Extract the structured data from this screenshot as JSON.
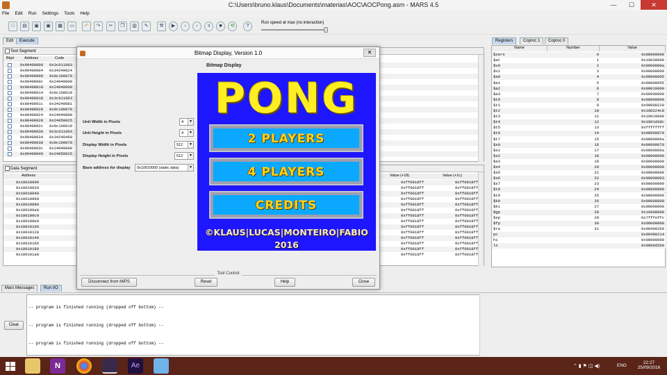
{
  "window": {
    "title": "C:\\Users\\bruno.klaus\\Documents\\materias\\AOC\\AOCPong.asm  -  MARS 4.5",
    "minimize": "—",
    "maximize": "☐",
    "close": "✕"
  },
  "menu": [
    "File",
    "Edit",
    "Run",
    "Settings",
    "Tools",
    "Help"
  ],
  "toolbar": {
    "runspeed_label": "Run speed at max (no interaction)",
    "buttons": [
      "new-icon",
      "open-icon",
      "save-icon",
      "saveas-icon",
      "dump-icon",
      "print-icon",
      "undo-icon",
      "redo-icon",
      "cut-icon",
      "copy-icon",
      "paste-icon",
      "findreplace-icon",
      "assemble-icon",
      "go-icon",
      "step-icon",
      "backstep-icon",
      "pause-icon",
      "stop-icon",
      "reset-icon",
      "help-icon"
    ]
  },
  "tabs": {
    "edit": "Edit",
    "execute": "Execute"
  },
  "text_segment": {
    "title": "Text Segment",
    "columns": [
      "Bkpt",
      "Address",
      "Code"
    ],
    "rows": [
      [
        "0x00400000",
        "0x3c011003"
      ],
      [
        "0x00400004",
        "0x34240024"
      ],
      [
        "0x00400008",
        "0x0c100078"
      ],
      [
        "0x0040000c",
        "0x24040000"
      ],
      [
        "0x00400010",
        "0x24040000"
      ],
      [
        "0x00400014",
        "0x0c100019"
      ],
      [
        "0x00400018",
        "0x3c011003"
      ],
      [
        "0x0040001c",
        "0x34240081"
      ],
      [
        "0x00400020",
        "0x0c100078"
      ],
      [
        "0x00400024",
        "0x24040008"
      ],
      [
        "0x00400028",
        "0x24050025"
      ],
      [
        "0x0040002c",
        "0x0c100019"
      ],
      [
        "0x00400030",
        "0x3c011003"
      ],
      [
        "0x00400034",
        "0x34240460"
      ],
      [
        "0x00400038",
        "0x0c100078"
      ],
      [
        "0x0040003c",
        "0x24040008"
      ],
      [
        "0x00400040",
        "0x24050025"
      ]
    ]
  },
  "data_segment": {
    "title": "Data Segment",
    "columns": [
      "Address",
      "Value (+18)",
      "Value (+1c)"
    ],
    "rows": [
      [
        "0x10010000",
        "0xff0018ff",
        "0xff0018ff"
      ],
      [
        "0x10010020",
        "0xff0018ff",
        "0xff0018ff"
      ],
      [
        "0x10010040",
        "0xff0018ff",
        "0xff0018ff"
      ],
      [
        "0x10010060",
        "0xff0018ff",
        "0xff0018ff"
      ],
      [
        "0x10010080",
        "0xff0018ff",
        "0xff0018ff"
      ],
      [
        "0x100100a0",
        "0xff0018ff",
        "0xff0018ff"
      ],
      [
        "0x100100c0",
        "0xff0018ff",
        "0xff0018ff"
      ],
      [
        "0x100100e0",
        "0xff0018ff",
        "0xff0018ff"
      ],
      [
        "0x10010100",
        "0xff0018ff",
        "0xff0018ff"
      ],
      [
        "0x10010120",
        "0xff0018ff",
        "0xff0018ff"
      ],
      [
        "0x10010140",
        "0xff0018ff",
        "0xff0018ff"
      ],
      [
        "0x10010160",
        "0xff0018ff",
        "0xff0018ff"
      ],
      [
        "0x10010180",
        "0xff0018ff",
        "0xff0018ff"
      ],
      [
        "0x100101a0",
        "0xff0018ff",
        "0xff0018ff"
      ]
    ]
  },
  "registers": {
    "tabs": [
      "Registers",
      "Coproc 1",
      "Coproc 0"
    ],
    "columns": [
      "Name",
      "Number",
      "Value"
    ],
    "rows": [
      [
        "$zero",
        "0",
        "0x00000000"
      ],
      [
        "$at",
        "1",
        "0x10030000"
      ],
      [
        "$v0",
        "2",
        "0x0000000a"
      ],
      [
        "$v1",
        "3",
        "0x00000000"
      ],
      [
        "$a0",
        "4",
        "0x00000005"
      ],
      [
        "$a1",
        "5",
        "0x00000055"
      ],
      [
        "$a2",
        "6",
        "0x00010000"
      ],
      [
        "$a3",
        "7",
        "0x00000000"
      ],
      [
        "$t0",
        "8",
        "0x00000000"
      ],
      [
        "$t1",
        "9",
        "0x00000220"
      ],
      [
        "$t2",
        "10",
        "0x100224c8"
      ],
      [
        "$t3",
        "11",
        "0x10010000"
      ],
      [
        "$t4",
        "12",
        "0x1001d3dc"
      ],
      [
        "$t5",
        "13",
        "0xffffffff"
      ],
      [
        "$t6",
        "14",
        "0x00000078"
      ],
      [
        "$t7",
        "15",
        "0x0000006a"
      ],
      [
        "$s0",
        "16",
        "0x00000078"
      ],
      [
        "$s1",
        "17",
        "0x0000006a"
      ],
      [
        "$s2",
        "18",
        "0x00000000"
      ],
      [
        "$s3",
        "19",
        "0x00000000"
      ],
      [
        "$s4",
        "20",
        "0x00000000"
      ],
      [
        "$s5",
        "21",
        "0x00000000"
      ],
      [
        "$s6",
        "22",
        "0x00000003"
      ],
      [
        "$s7",
        "23",
        "0x00000000"
      ],
      [
        "$t8",
        "24",
        "0x00000000"
      ],
      [
        "$t9",
        "25",
        "0x00000000"
      ],
      [
        "$k0",
        "26",
        "0x00000000"
      ],
      [
        "$k1",
        "27",
        "0x00000000"
      ],
      [
        "$gp",
        "28",
        "0x10008000"
      ],
      [
        "$sp",
        "29",
        "0x7fffeffc"
      ],
      [
        "$fp",
        "30",
        "0x00000000"
      ],
      [
        "$ra",
        "31",
        "0x00400260"
      ],
      [
        "pc",
        "",
        "0x00400214"
      ],
      [
        "hi",
        "",
        "0x00000000"
      ],
      [
        "lo",
        "",
        "0x0000d200"
      ]
    ]
  },
  "messages": {
    "tabs": [
      "Mars Messages",
      "Run I/O"
    ],
    "clear": "Clear",
    "lines": [
      "-- program is finished running (dropped off bottom) --",
      "-- program is finished running (dropped off bottom) --",
      "-- program is finished running (dropped off bottom) --"
    ]
  },
  "dialog": {
    "title": "Bitmap Display, Version 1.0",
    "close": "✕",
    "heading": "Bitmap Display",
    "fields": [
      {
        "label": "Unit Width in Pixels",
        "value": "4"
      },
      {
        "label": "Unit Height in Pixels",
        "value": "4"
      },
      {
        "label": "Display Width in Pixels",
        "value": "512"
      },
      {
        "label": "Display Height in Pixels",
        "value": "512"
      },
      {
        "label": "Base address for display",
        "value": "0x10010000 (static data)"
      }
    ],
    "tool_control": "Tool Control",
    "buttons": {
      "disconnect": "Disconnect from MIPS",
      "reset": "Reset",
      "help": "Help",
      "close": "Close"
    },
    "screen": {
      "title": "PONG",
      "buttons": [
        "2 PLAYERS",
        "4 PLAYERS",
        "CREDITS"
      ],
      "credits": "©KLAUS|LUCAS|MONTEIRO|FABIO",
      "year": "2016",
      "colors": {
        "bg": "#1e16ff",
        "title": "#ffee22",
        "button": "#0aa9ff"
      }
    }
  },
  "taskbar": {
    "lang": "ENG",
    "time": "22:27",
    "date": "25/09/2016"
  }
}
